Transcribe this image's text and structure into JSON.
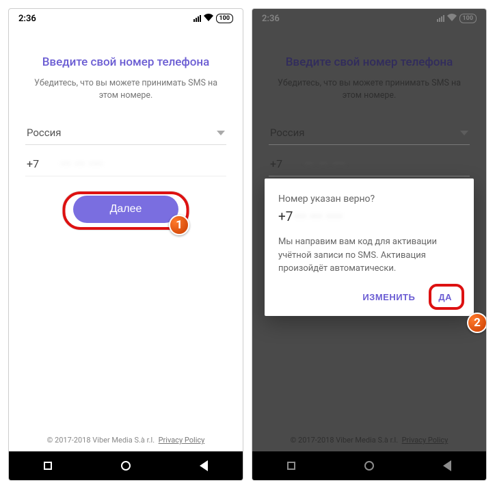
{
  "status": {
    "time": "2:36",
    "battery": "100"
  },
  "screen": {
    "title": "Введите свой номер телефона",
    "subtitle": "Убедитесь, что вы можете принимать SMS на этом номере.",
    "country": "Россия",
    "code": "+7",
    "number_obscured": "··· ··· ····",
    "next_label": "Далее"
  },
  "footer": {
    "copyright": "© 2017-2018 Viber Media S.à r.l.",
    "privacy": "Privacy Policy"
  },
  "dialog": {
    "question": "Номер указан верно?",
    "number_prefix": "+7",
    "body": "Мы направим вам код для активации учётной записи по SMS. Активация произойдёт автоматически.",
    "change": "ИЗМЕНИТЬ",
    "yes": "ДА"
  },
  "steps": {
    "one": "1",
    "two": "2"
  }
}
